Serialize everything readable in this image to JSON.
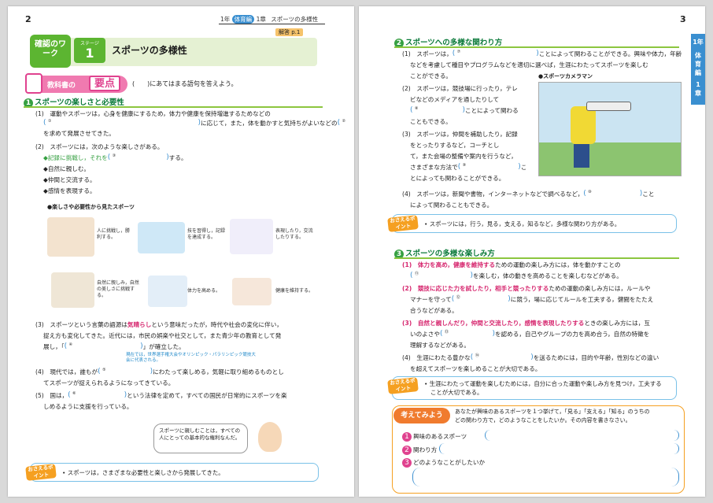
{
  "left": {
    "page_number": "2",
    "header": {
      "grade": "1年",
      "tag": "体育編",
      "chapter": "1章",
      "title": "スポーツの多様性"
    },
    "title_block": {
      "kakunin": "確認のワーク",
      "stage_label": "ステージ",
      "stage_num": "1",
      "title": "スポーツの多様性",
      "answer_ref": "解答 p.1"
    },
    "youten": {
      "label": "教科書の",
      "key": "要点",
      "instruction": "(　　)にあてはまる語句を答えよう。"
    },
    "sec1": {
      "num": "1",
      "title": "スポーツの楽しさと必要性",
      "p1a": "(1)　運動やスポーツは，心身を健康にするため，体力や健康を保持増進するためなどの",
      "p1b": "に応じて，また，体を動かすと気持ちがよいなどの",
      "p1c": "を求めて発展させてきた。",
      "p2": "(2)　スポーツには，次のような楽しさがある。",
      "b1a": "◆記録に挑戦し，それを",
      "b1b": "する。",
      "b2": "◆自然に親しむ。",
      "b3": "◆仲間と交流する。",
      "b4": "◆感情を表現する。",
      "illus_title": "●楽しさや必要性から見たスポーツ",
      "captions": [
        "人に挑戦し，勝利する。",
        "技を習得し，記録を達成する。",
        "表現したり，交流したりする。",
        "自然に親しみ，自然の美しさに挑戦する。",
        "体力を高める。",
        "健康を維持する。"
      ],
      "p3a": "(3)　スポーツという言葉の語源は",
      "p3red": "気晴らし",
      "p3b": "という意味だったが，時代や社会の変化に伴い，",
      "p3c": "捉え方も変化してきた。近代には，市民の娯楽や社交として，また青少年の教育として発",
      "p3d": "展し，「",
      "p3e": "」が確立した。",
      "note": "現在では，世界選手権大会やオリンピック・パラリンピック競技大会に代表される。",
      "p4a": "(4)　現代では，誰もが",
      "p4b": "にわたって楽しめる，気軽に取り組めるものとし",
      "p4c": "てスポーツが捉えられるようになってきている。",
      "p5a": "(5)　国は，",
      "p5b": "という法律を定めて，すべての国民が日常的にスポーツを楽",
      "p5c": "しめるように支援を行っている。"
    },
    "speech": "スポーツに親しむことは，すべての人にとっての基本的な権利なんだ。",
    "osaeru": {
      "label": "おさえるポイント",
      "text": "• スポーツは，さまざまな必要性と楽しさから発展してきた。"
    },
    "blanks": [
      "①",
      "②",
      "③",
      "④",
      "⑤",
      "⑥"
    ]
  },
  "right": {
    "page_number": "3",
    "side_tab": {
      "grade": "1年",
      "tag": "体育編",
      "chapter": "1章"
    },
    "sec2": {
      "num": "2",
      "title": "スポーツへの多様な関わり方",
      "p1a": "(1)　スポーツは，",
      "p1b": "ことによって関わることができる。興味や体力，年齢",
      "p1c": "などを考慮して種目やプログラムなどを適切に選べば，生涯にわたってスポーツを楽しむ",
      "p1d": "ことができる。",
      "p2a": "(2)　スポーツは，競技場に行ったり，テレ",
      "p2b": "ビなどのメディアを通したりして",
      "p2c": "ことによって関わる",
      "p2d": "こともできる。",
      "p3a": "(3)　スポーツは，仲間を補助したり，記録",
      "p3b": "をとったりするなど，コーチとし",
      "p3c": "て，また会場の整備や案内を行うなど，",
      "p3d": "さまざまな方法で",
      "p3e": "こ",
      "p3f": "とによっても関わることができる。",
      "p4a": "(4)　スポーツは，新聞や書物，インターネットなどで調べるなど，",
      "p4b": "こと",
      "p4c": "によって関わることもできる。",
      "camera_title": "●スポーツカメラマン"
    },
    "osaeru1": {
      "label": "おさえるポイント",
      "text": "• スポーツには，行う，見る，支える，知るなど，多様な関わり方がある。"
    },
    "sec3": {
      "num": "3",
      "title": "スポーツの多様な楽しみ方",
      "p1red": "(1)　体力を高め，健康を維持する",
      "p1a": "ための運動の楽しみ方には，体を動かすことの",
      "p1b": "を楽しむ，体の動きを高めることを楽しむなどがある。",
      "p2red": "(2)　競技に応じた力を試したり，相手と競ったりする",
      "p2a": "ための運動の楽しみ方には，ルールや",
      "p2b": "マナーを守って",
      "p2c": "に競う，場に応じてルールを工夫する，健闘をたたえ",
      "p2d": "合うなどがある。",
      "p3red": "(3)　自然と親しんだり，仲間と交流したり，感情を表現したりする",
      "p3a": "ときの楽しみ方には，互",
      "p3b": "いのよさや",
      "p3c": "を認める，自己やグループの力を高め合う，自然の特徴を",
      "p3d": "理解するなどがある。",
      "p4a": "(4)　生涯にわたる豊かな",
      "p4b": "を送るためには，目的や年齢，性別などの違い",
      "p4c": "を超えてスポーツを楽しめることが大切である。"
    },
    "osaeru2": {
      "label": "おさえるポイント",
      "text1": "• 生涯にわたって運動を楽しむためには，自分に合った運動や楽しみ方を見つけ，工夫する",
      "text2": "ことが大切である。"
    },
    "kangaete": {
      "label": "考えてみよう",
      "q1": "あなたが興味のあるスポーツを１つ挙げて，「見る」「支える」「知る」のうちの",
      "q2": "どの関わり方で，どのようなことをしたいか。その内容を書きなさい。",
      "items": [
        "興味のあるスポーツ",
        "関わり方",
        "どのようなことがしたいか"
      ]
    },
    "blanks": [
      "⑦",
      "⑧",
      "⑨",
      "⑩",
      "⑪",
      "⑫",
      "⑬",
      "⑭",
      "⑮"
    ]
  }
}
